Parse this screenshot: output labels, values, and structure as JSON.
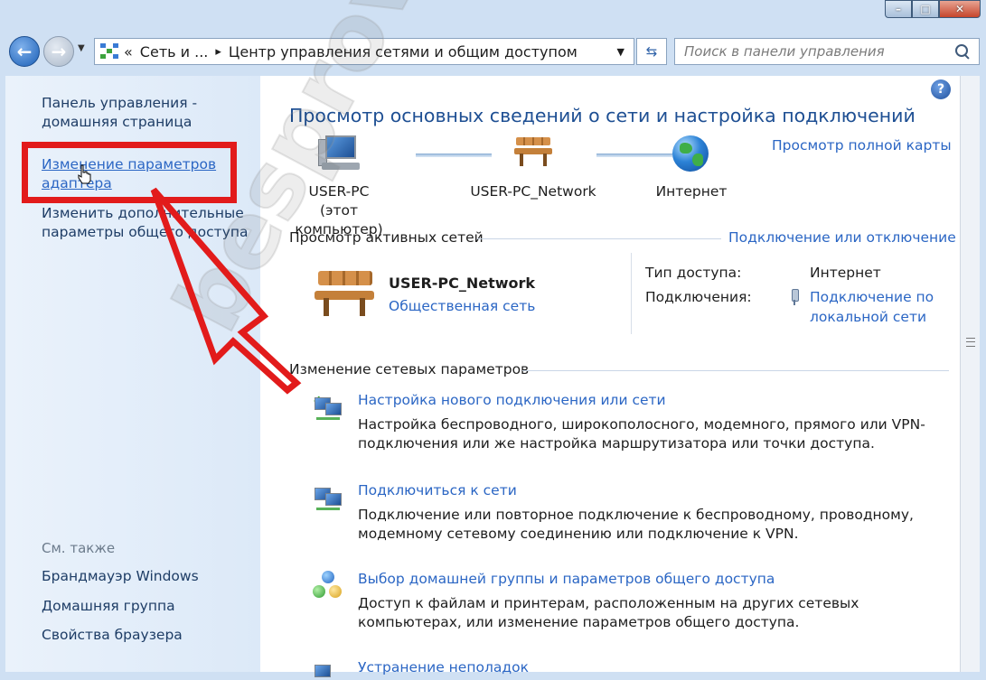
{
  "window": {
    "controls": {
      "minimize": "–",
      "maximize": "□",
      "close": "✕"
    }
  },
  "toolbar": {
    "back_icon": "back-arrow-icon",
    "forward_icon": "forward-arrow-icon",
    "breadcrumb": {
      "overflow": "«",
      "items": [
        "Сеть и ...",
        "Центр управления сетями и общим доступом"
      ],
      "separator": "▸"
    },
    "refresh_glyph": "⇆",
    "search": {
      "placeholder": "Поиск в панели управления"
    }
  },
  "sidebar": {
    "home": "Панель управления - домашняя страница",
    "adapter_settings": "Изменение параметров адаптера",
    "sharing_settings": "Изменить дополнительные параметры общего доступа",
    "see_also_title": "См. также",
    "see_also": [
      "Брандмауэр Windows",
      "Домашняя группа",
      "Свойства браузера"
    ]
  },
  "main": {
    "help": "?",
    "title": "Просмотр основных сведений о сети и настройка подключений",
    "full_map_link": "Просмотр полной карты",
    "map": {
      "pc_name": "USER-PC",
      "pc_sub": "(этот компьютер)",
      "network": "USER-PC_Network",
      "internet": "Интернет"
    },
    "active_networks": {
      "heading": "Просмотр активных сетей",
      "connect_link": "Подключение или отключение",
      "network_name": "USER-PC_Network",
      "network_type": "Общественная сеть",
      "access_type_label": "Тип доступа:",
      "access_type_value": "Интернет",
      "connections_label": "Подключения:",
      "connections_value": "Подключение по локальной сети"
    },
    "change_settings": {
      "heading": "Изменение сетевых параметров",
      "tasks": [
        {
          "title": "Настройка нового подключения или сети",
          "desc": "Настройка беспроводного, широкополосного, модемного, прямого или VPN-подключения или же настройка маршрутизатора или точки доступа."
        },
        {
          "title": "Подключиться к сети",
          "desc": "Подключение или повторное подключение к беспроводному, проводному, модемному сетевому соединению или подключение к VPN."
        },
        {
          "title": "Выбор домашней группы и параметров общего доступа",
          "desc": "Доступ к файлам и принтерам, расположенным на других сетевых компьютерах, или изменение параметров общего доступа."
        },
        {
          "title": "Устранение неполадок",
          "desc": ""
        }
      ]
    }
  },
  "watermark": "besprovodnik.ru",
  "colors": {
    "link": "#2b66c4",
    "title": "#1e4f93",
    "highlight": "#e21b1b",
    "sidebar_bg": "#dce9f8"
  }
}
